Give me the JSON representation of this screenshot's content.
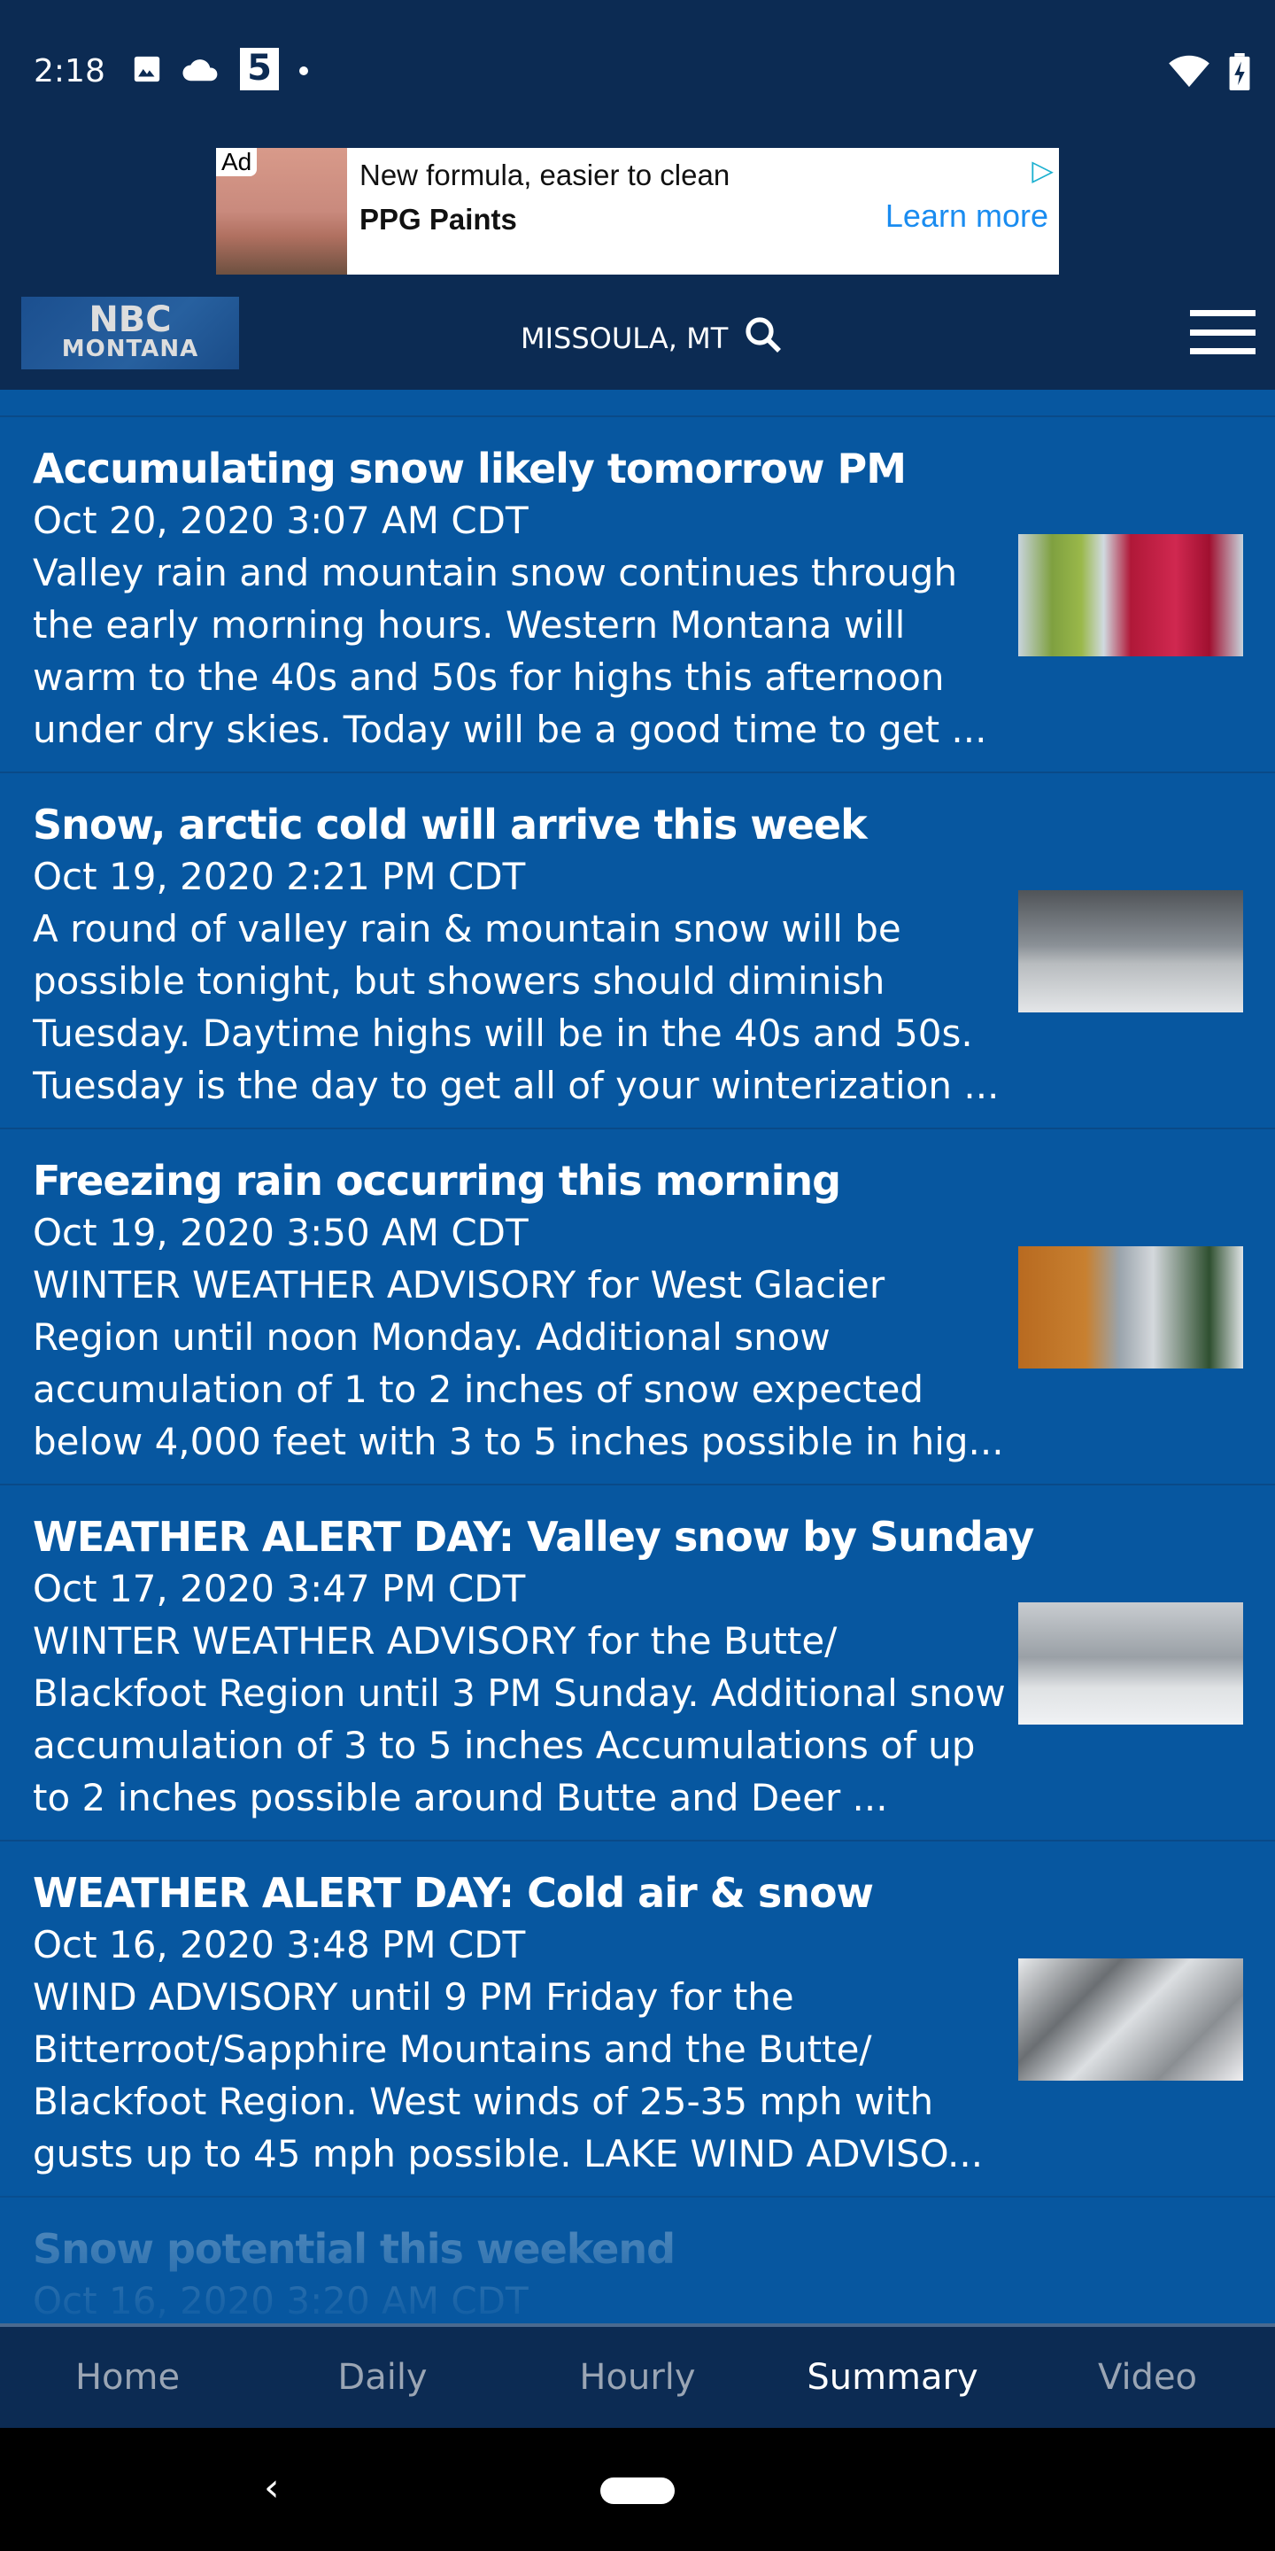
{
  "status_bar": {
    "time": "2:18",
    "icons": [
      "image-icon",
      "cloud-icon",
      "first-alert-5-icon",
      "dot-icon"
    ],
    "right_icons": [
      "wifi-icon",
      "battery-charging-icon"
    ]
  },
  "ad": {
    "badge": "Ad",
    "headline": "New formula, easier to clean",
    "advertiser": "PPG Paints",
    "cta": "Learn more"
  },
  "header": {
    "logo_text": "NBC MONTANA",
    "logo_line1": "NBC",
    "logo_line2": "MONTANA",
    "location": "MISSOULA, MT"
  },
  "articles": [
    {
      "title": "Accumulating snow likely tomorrow PM",
      "date": "Oct 20, 2020 3:07 AM CDT",
      "summary": "Valley rain and mountain snow continues through the early morning hours. Western Montana will warm to the 40s and 50s for highs this afternoon under dry skies. Today will be a good time to get ...",
      "thumb": "trees"
    },
    {
      "title": "Snow, arctic cold will arrive this week",
      "date": "Oct 19, 2020 2:21 PM CDT",
      "summary": "A round of valley rain & mountain snow will be possible tonight, but showers should diminish Tuesday. Daytime highs will be in the 40s and 50s. Tuesday is the day to get all of your winterization ...",
      "thumb": "field"
    },
    {
      "title": "Freezing rain occurring this morning",
      "date": "Oct 19, 2020 3:50 AM CDT",
      "summary": "WINTER WEATHER ADVISORY for West Glacier Region until noon Monday. Additional snow accumulation of 1 to 2 inches of snow expected below 4,000 feet with 3 to 5 inches possible in hig...",
      "thumb": "lake"
    },
    {
      "title": "WEATHER ALERT DAY: Valley snow by Sunday",
      "date": "Oct 17, 2020 3:47 PM CDT",
      "summary": "WINTER WEATHER ADVISORY for the Butte/ Blackfoot Region until 3 PM Sunday. Additional snow accumulation of 3 to 5 inches Accumulations of up to 2 inches possible around Butte and Deer ...",
      "thumb": "houses"
    },
    {
      "title": "WEATHER ALERT DAY: Cold air & snow",
      "date": "Oct 16, 2020 3:48 PM CDT",
      "summary": "WIND ADVISORY until 9 PM Friday for the Bitterroot/Sapphire Mountains and the Butte/ Blackfoot Region. West winds of 25-35 mph with gusts up to 45 mph possible. LAKE WIND ADVISO...",
      "thumb": "deck"
    },
    {
      "title": "Snow potential this weekend",
      "date": "Oct 16, 2020 3:20 AM CDT"
    }
  ],
  "tabs": [
    {
      "label": "Home"
    },
    {
      "label": "Daily"
    },
    {
      "label": "Hourly"
    },
    {
      "label": "Summary",
      "active": true
    },
    {
      "label": "Video"
    }
  ],
  "colors": {
    "header_bg": "#0c2b53",
    "list_bg": "#0757a0",
    "active_tab": "#ffffff",
    "inactive_tab": "#9aa5b4",
    "ad_cta": "#1a8cf0"
  }
}
